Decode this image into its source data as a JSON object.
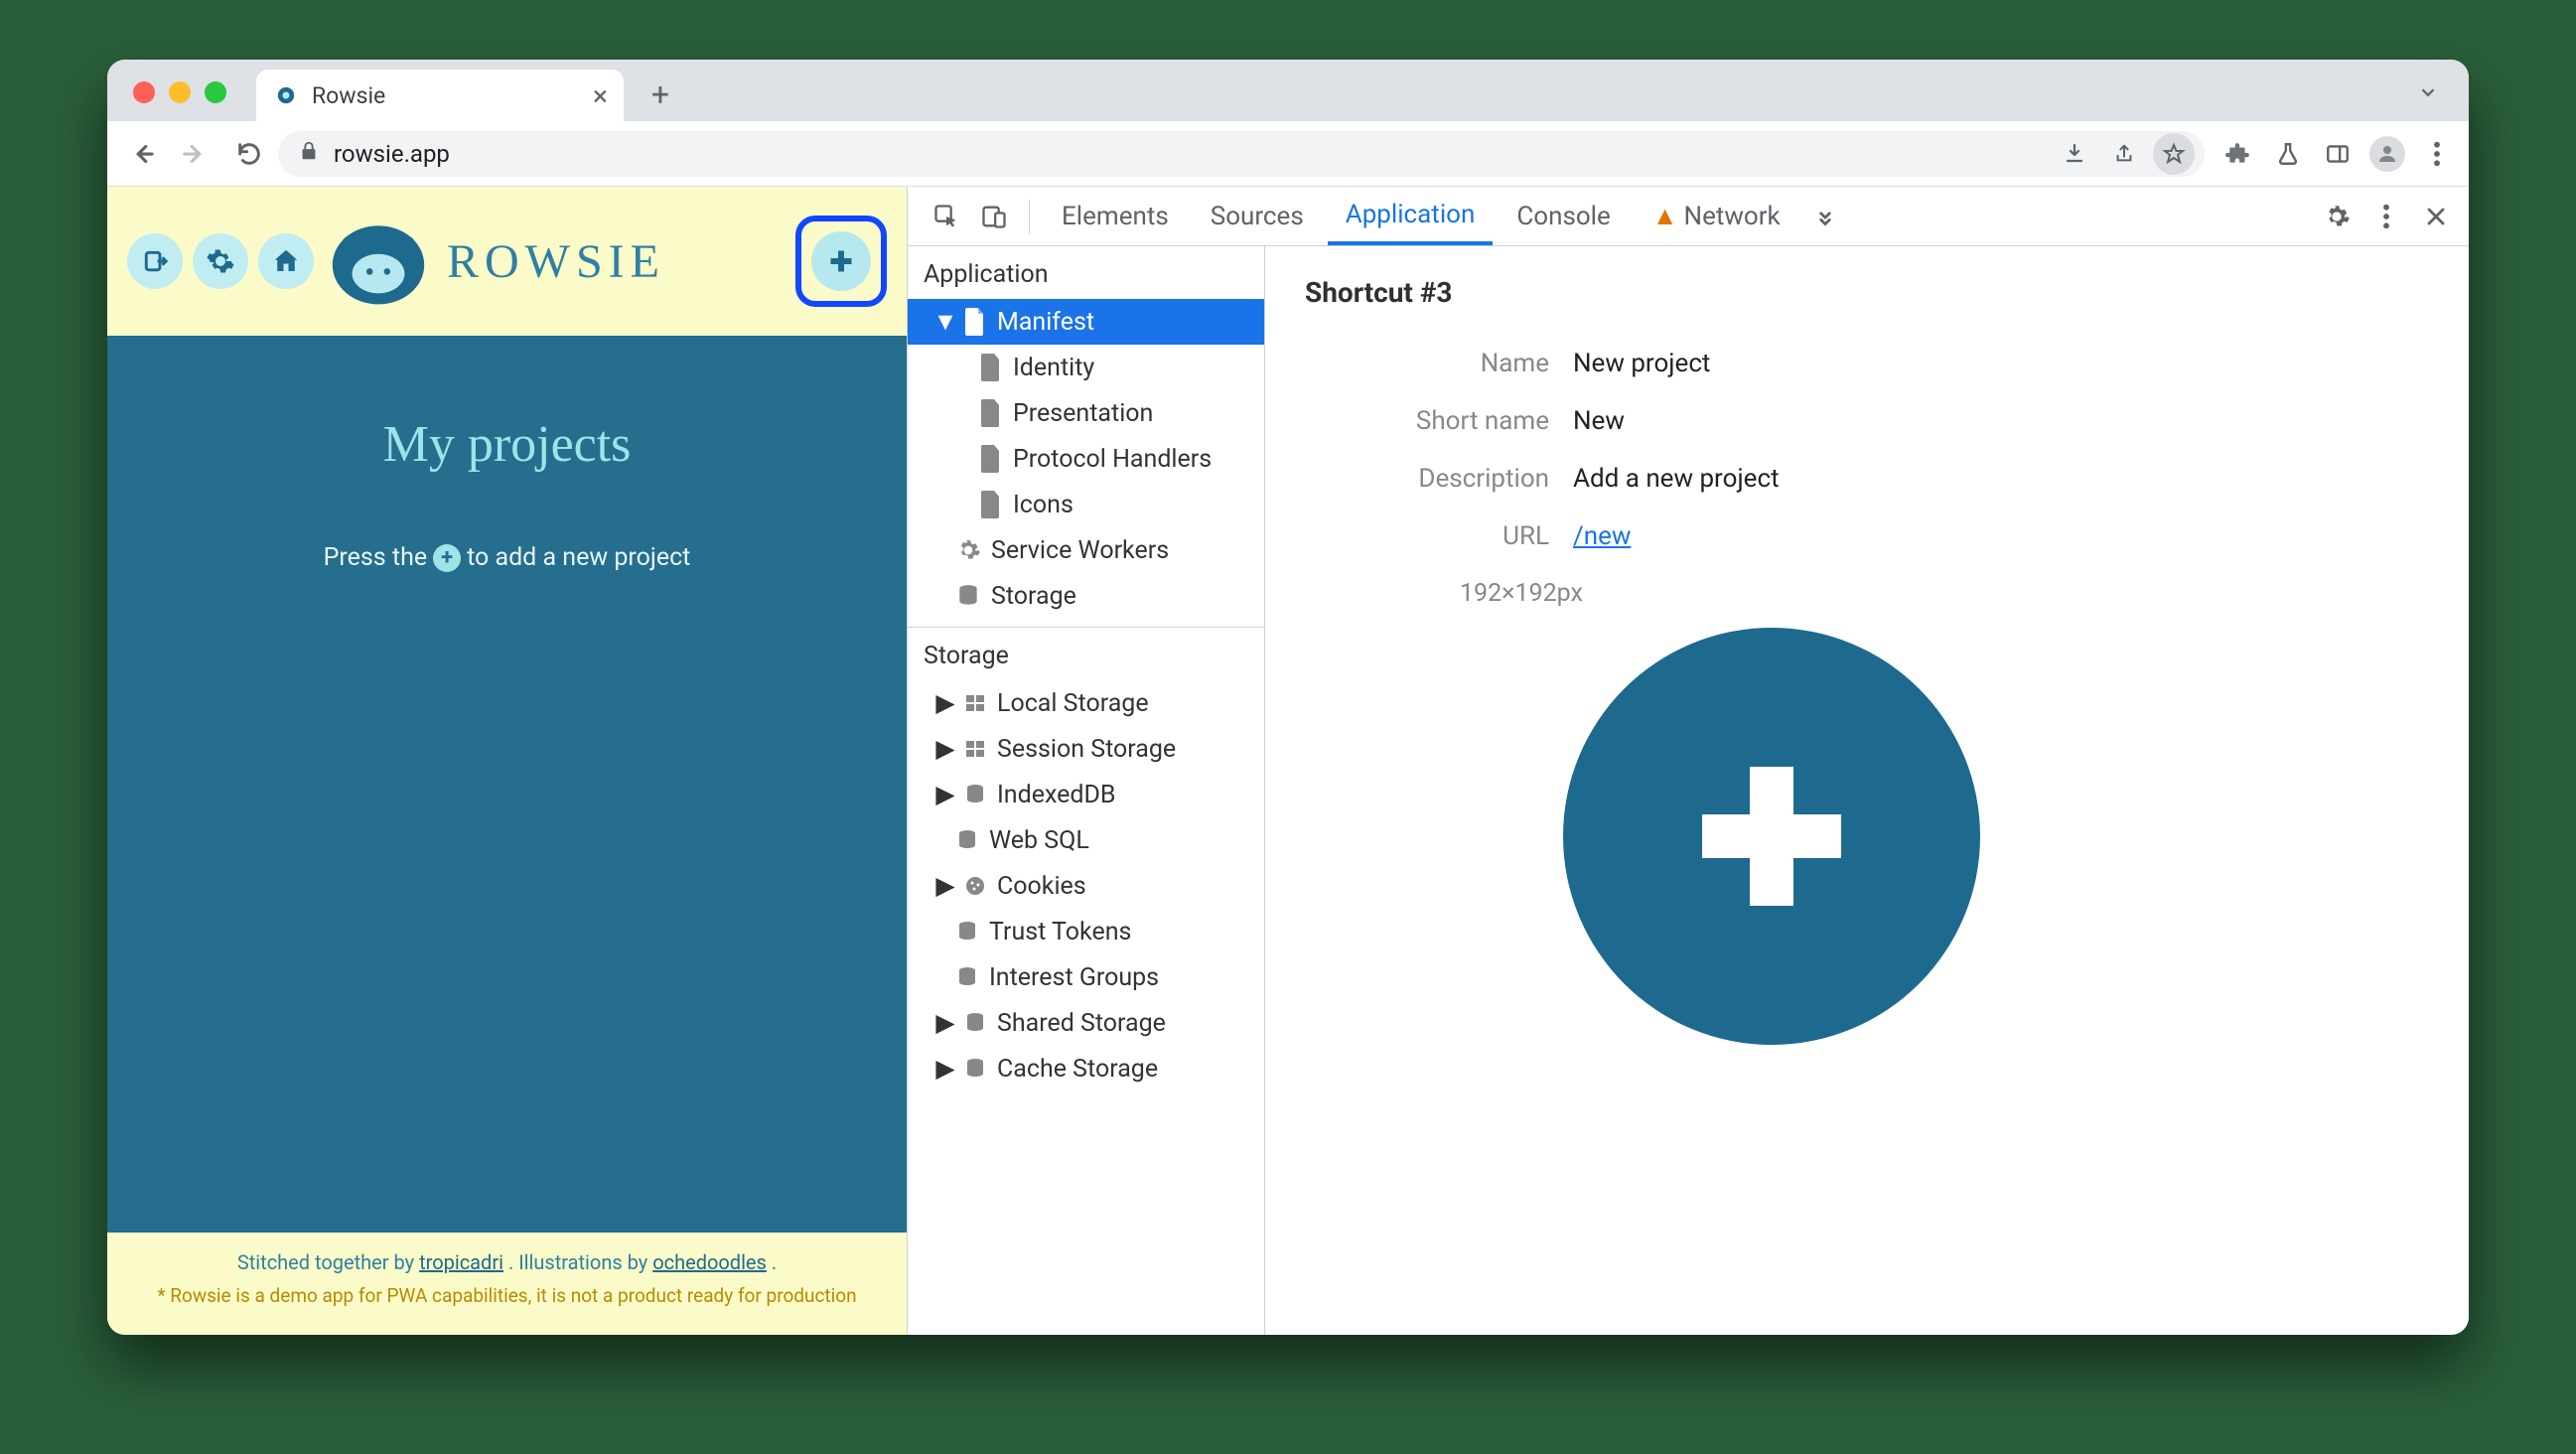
{
  "browser": {
    "tab_title": "Rowsie",
    "url": "rowsie.app"
  },
  "page": {
    "wordmark": "ROWSIE",
    "title": "My projects",
    "hint_prefix": "Press the ",
    "hint_suffix": " to add a new project",
    "footer_line_prefix": "Stitched together by ",
    "footer_author1": "tropicadri",
    "footer_line_mid": ". Illustrations by ",
    "footer_author2": "ochedoodles",
    "footer_line_suffix": ".",
    "disclaimer": "* Rowsie is a demo app for PWA capabilities, it is not a product ready for production"
  },
  "devtools": {
    "tabs": [
      "Elements",
      "Sources",
      "Application",
      "Console",
      "Network"
    ],
    "active_tab": "Application",
    "sidebar": {
      "section1": "Application",
      "items1": [
        "Manifest",
        "Identity",
        "Presentation",
        "Protocol Handlers",
        "Icons",
        "Service Workers",
        "Storage"
      ],
      "section2": "Storage",
      "items2": [
        "Local Storage",
        "Session Storage",
        "IndexedDB",
        "Web SQL",
        "Cookies",
        "Trust Tokens",
        "Interest Groups",
        "Shared Storage",
        "Cache Storage"
      ]
    },
    "detail": {
      "title": "Shortcut #3",
      "name_label": "Name",
      "name_value": "New project",
      "shortname_label": "Short name",
      "shortname_value": "New",
      "desc_label": "Description",
      "desc_value": "Add a new project",
      "url_label": "URL",
      "url_value": "/new",
      "icon_dim": "192×192px"
    }
  }
}
